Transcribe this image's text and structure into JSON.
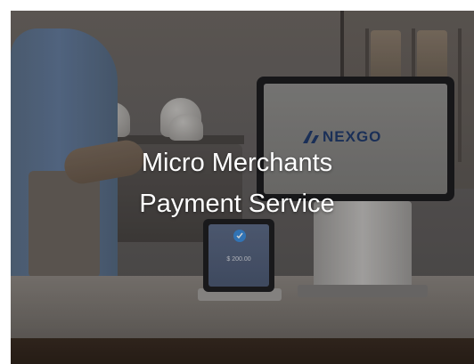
{
  "hero": {
    "caption_line1": "Micro Merchants",
    "caption_line2": "Payment Service",
    "monitor_brand": "NEXGO",
    "terminal_amount": "$ 200.00"
  },
  "icons": {
    "brand_logo": "nexgo-logo-icon",
    "check": "check-icon"
  },
  "colors": {
    "brand_text": "#203a6b",
    "caption_text": "#ffffff",
    "badge": "#3c8ddc"
  }
}
